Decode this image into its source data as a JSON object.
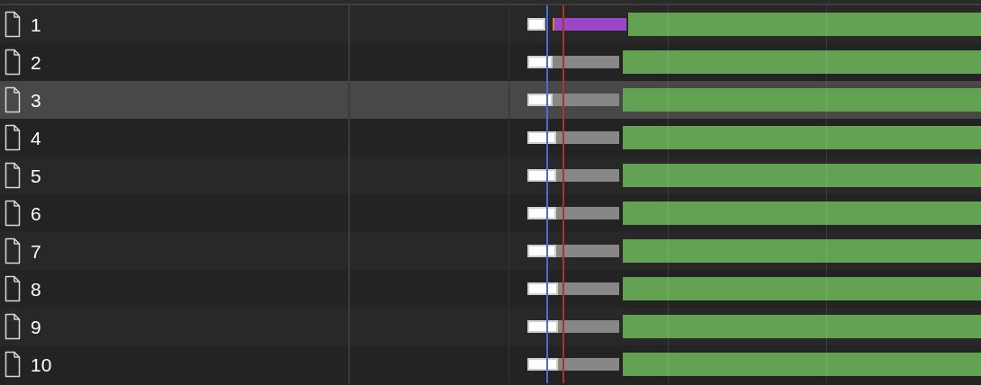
{
  "rows": [
    {
      "name": "1",
      "selected": false,
      "kind": "connect"
    },
    {
      "name": "2",
      "selected": false,
      "kind": "wait"
    },
    {
      "name": "3",
      "selected": true,
      "kind": "wait"
    },
    {
      "name": "4",
      "selected": false,
      "kind": "wait"
    },
    {
      "name": "5",
      "selected": false,
      "kind": "wait"
    },
    {
      "name": "6",
      "selected": false,
      "kind": "wait"
    },
    {
      "name": "7",
      "selected": false,
      "kind": "wait"
    },
    {
      "name": "8",
      "selected": false,
      "kind": "wait"
    },
    {
      "name": "9",
      "selected": false,
      "kind": "wait"
    },
    {
      "name": "10",
      "selected": false,
      "kind": "wait"
    }
  ]
}
